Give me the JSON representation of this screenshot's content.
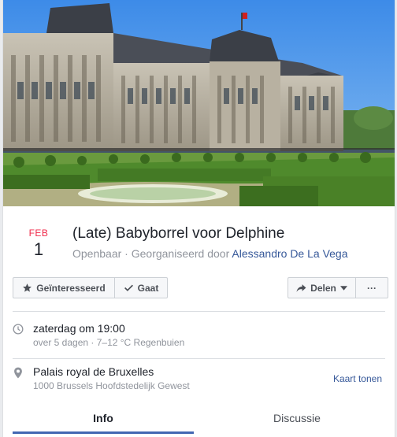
{
  "event": {
    "month": "FEB",
    "day": "1",
    "title": "(Late) Babyborrel voor Delphine",
    "privacy": "Openbaar",
    "separator": " · ",
    "organized_by": "Georganiseerd door",
    "organizer": "Alessandro De La Vega"
  },
  "actions": {
    "interested_label": "Geïnteresseerd",
    "going_label": "Gaat",
    "share_label": "Delen",
    "more_label": "···"
  },
  "when": {
    "main": "zaterdag om 19:00",
    "sub": "over 5 dagen · 7–12 °C Regenbuien"
  },
  "where": {
    "main": "Palais royal de Bruxelles",
    "sub": "1000 Brussels Hoofdstedelijk Gewest",
    "map_link": "Kaart tonen"
  },
  "tabs": [
    {
      "label": "Info"
    },
    {
      "label": "Discussie"
    }
  ],
  "icons": {
    "interested": "star-icon",
    "going": "check-icon",
    "share": "share-arrow-icon",
    "share_dropdown": "chevron-down-icon",
    "time": "clock-icon",
    "location": "map-pin-icon"
  },
  "colors": {
    "month": "#f02849",
    "link": "#365899",
    "tab_active": "#4267b2"
  }
}
